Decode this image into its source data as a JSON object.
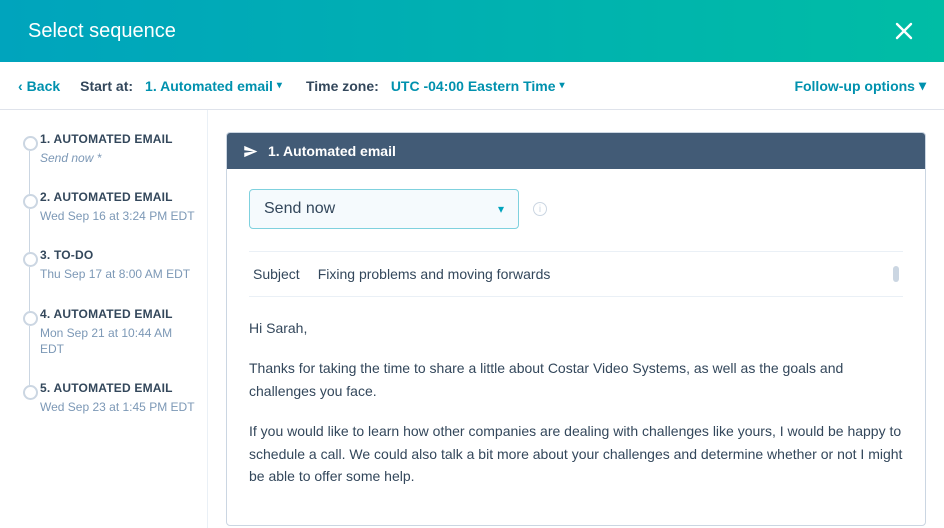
{
  "header": {
    "title": "Select sequence"
  },
  "toolbar": {
    "back": "Back",
    "start_label": "Start at:",
    "start_value": "1. Automated email",
    "tz_label": "Time zone:",
    "tz_value": "UTC -04:00 Eastern Time",
    "followup": "Follow-up options"
  },
  "steps": [
    {
      "title": "1. AUTOMATED EMAIL",
      "sub": "Send now *",
      "italic": true
    },
    {
      "title": "2. AUTOMATED EMAIL",
      "sub": "Wed Sep 16 at 3:24 PM EDT"
    },
    {
      "title": "3. TO-DO",
      "sub": "Thu Sep 17 at 8:00 AM EDT"
    },
    {
      "title": "4. AUTOMATED EMAIL",
      "sub": "Mon Sep 21 at 10:44 AM EDT"
    },
    {
      "title": "5. AUTOMATED EMAIL",
      "sub": "Wed Sep 23 at 1:45 PM EDT"
    }
  ],
  "card": {
    "title": "1. Automated email",
    "send_select": "Send now",
    "subject_label": "Subject",
    "subject_value": "Fixing problems and moving forwards",
    "body": {
      "greeting": "Hi Sarah,",
      "p1": " Thanks for taking the time to share a little about Costar Video Systems, as well as the goals and challenges you face.",
      "p2": " If you would like to learn how other companies are dealing with challenges like yours, I would be happy to schedule a call. We could also talk a bit more about your challenges and determine whether or not I might be able to offer some help."
    }
  }
}
